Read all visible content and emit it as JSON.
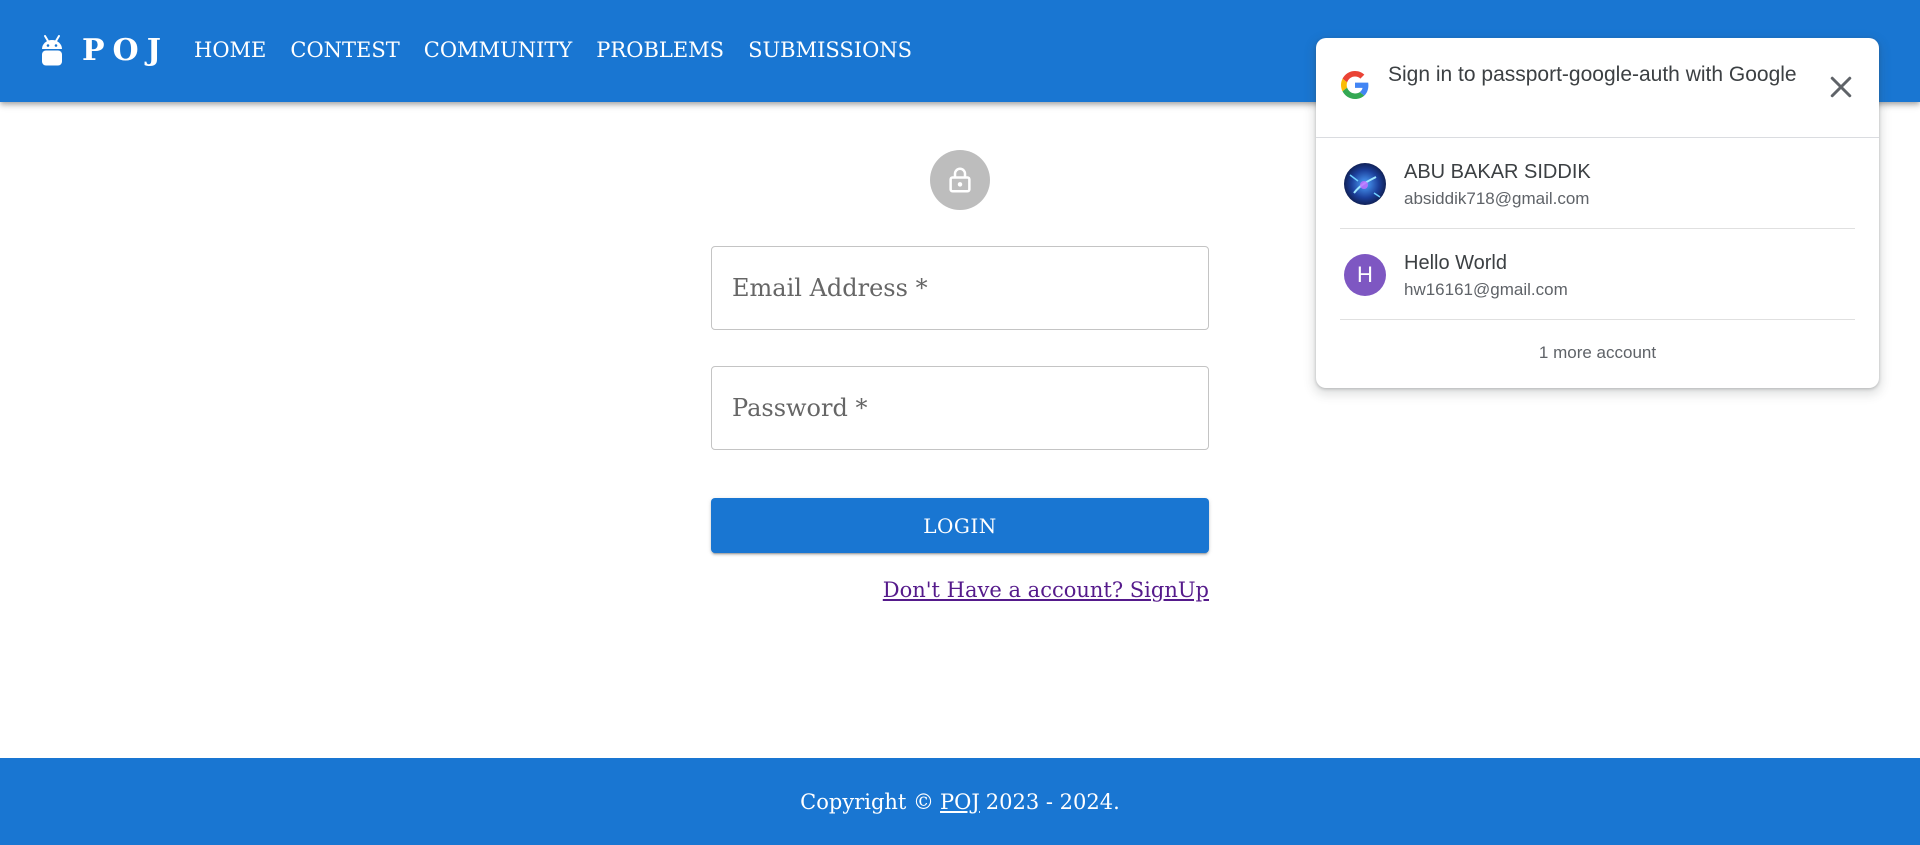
{
  "colors": {
    "primary": "#1976d2",
    "link_visited": "#551a8b",
    "avatar_gray": "#bdbdbd",
    "account_letter_bg": "#7e57c2"
  },
  "header": {
    "brand": "POJ",
    "logo_icon": "android-icon",
    "nav": [
      "HOME",
      "CONTEST",
      "COMMUNITY",
      "PROBLEMS",
      "SUBMISSIONS"
    ]
  },
  "login": {
    "lock_icon": "lock-icon",
    "email_placeholder": "Email Address *",
    "email_value": "",
    "password_placeholder": "Password *",
    "password_value": "",
    "submit_label": "LOGIN",
    "signup_link": "Don't Have a account? SignUp"
  },
  "footer": {
    "prefix": "Copyright ©",
    "brand_link": "POJ",
    "suffix": "2023 - 2024."
  },
  "google_prompt": {
    "title": "Sign in to passport-google-auth with Google",
    "close_icon": "close-icon",
    "accounts": [
      {
        "name": "ABU BAKAR SIDDIK",
        "email": "absiddik718@gmail.com",
        "avatar": "photo"
      },
      {
        "name": "Hello World",
        "email": "hw16161@gmail.com",
        "avatar": "H"
      }
    ],
    "more_accounts": "1 more account"
  }
}
